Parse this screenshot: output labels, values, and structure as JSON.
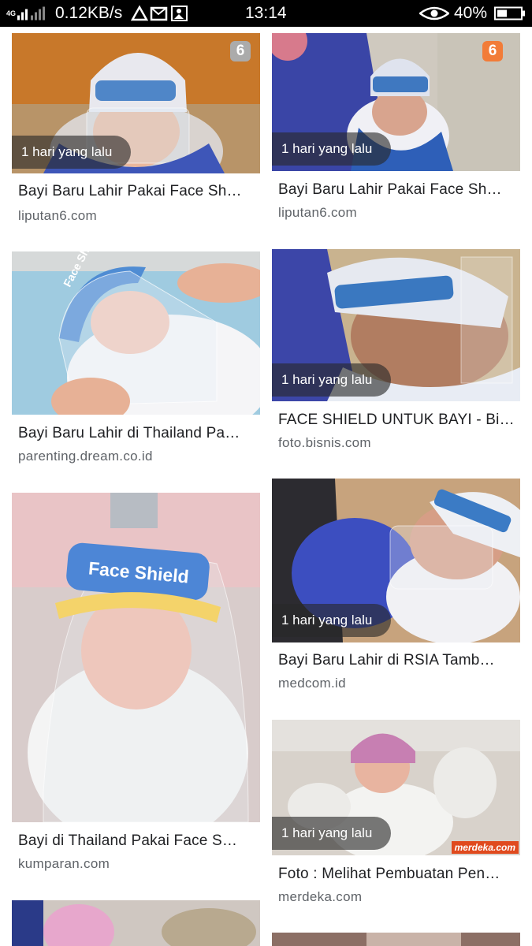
{
  "status_bar": {
    "network": "4G",
    "speed": "0.12KB/s",
    "time": "13:14",
    "battery": "40%"
  },
  "results": [
    {
      "badge": "1 hari yang lalu",
      "title": "Bayi Baru Lahir Pakai Face Sh…",
      "source": "liputan6.com",
      "logo": "6"
    },
    {
      "badge": "1 hari yang lalu",
      "title": "Bayi Baru Lahir Pakai Face Sh…",
      "source": "liputan6.com",
      "logo": "6"
    },
    {
      "title": "Bayi Baru Lahir di Thailand Pa…",
      "source": "parenting.dream.co.id",
      "shield_text": "Face Shield"
    },
    {
      "badge": "1 hari yang lalu",
      "title": "FACE SHIELD UNTUK BAYI - Bi…",
      "source": "foto.bisnis.com"
    },
    {
      "title": "Bayi di Thailand Pakai Face S…",
      "source": "kumparan.com",
      "shield_text": "Face Shield"
    },
    {
      "badge": "1 hari yang lalu",
      "title": "Bayi Baru Lahir di RSIA Tamb…",
      "source": "medcom.id"
    },
    {
      "badge": "1 hari yang lalu",
      "title": "Foto : Melihat Pembuatan Pen…",
      "source": "merdeka.com",
      "watermark": "merdeka.com"
    }
  ]
}
